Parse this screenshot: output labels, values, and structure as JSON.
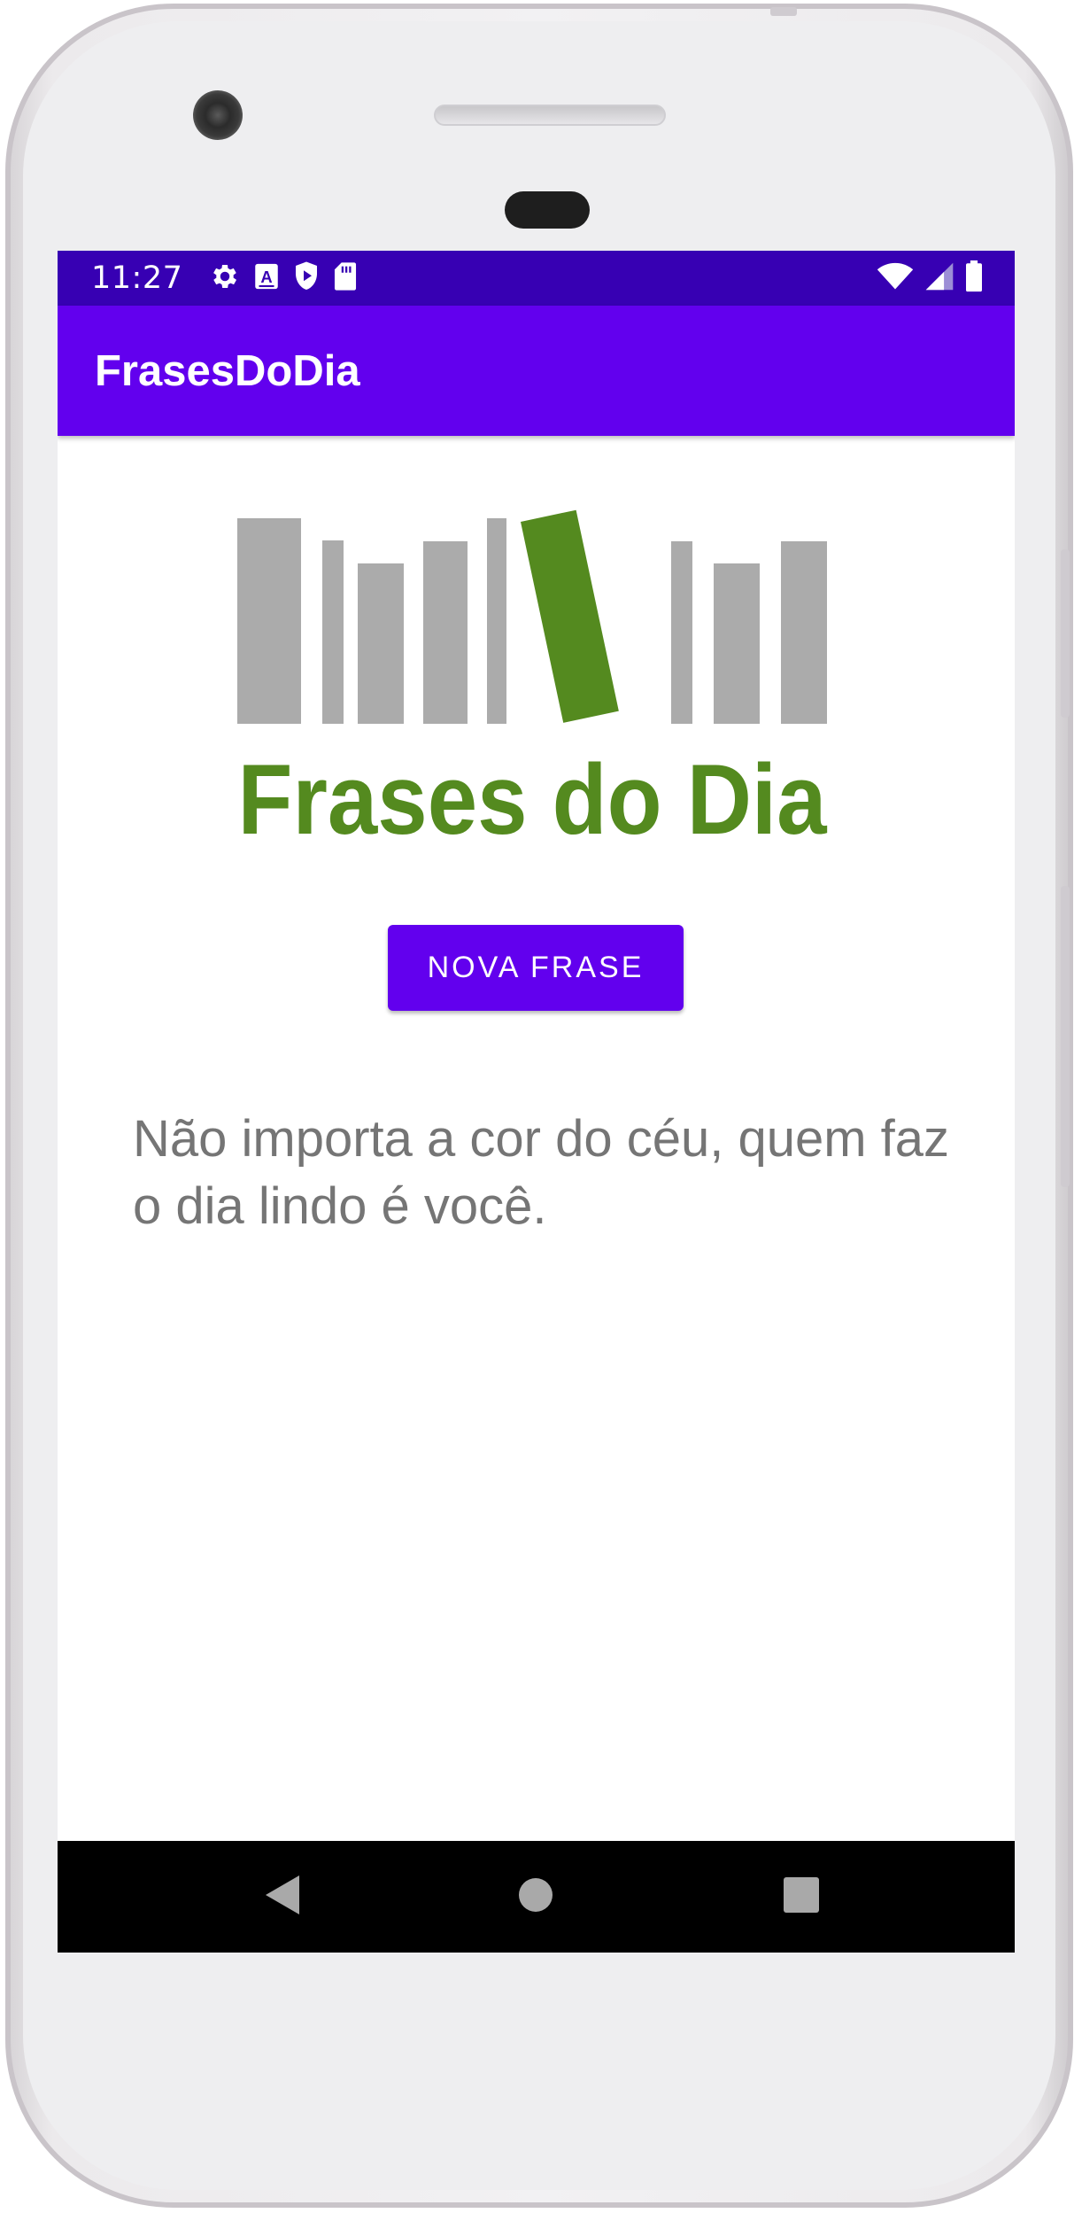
{
  "status_bar": {
    "time": "11:27",
    "left_icons": [
      "gear-icon",
      "text-a-icon",
      "shield-play-icon",
      "sd-card-icon"
    ],
    "right_icons": [
      "wifi-icon",
      "cell-signal-icon",
      "battery-icon"
    ],
    "background_color": "#3700b3"
  },
  "app_bar": {
    "title": "FrasesDoDia",
    "background_color": "#6200ee"
  },
  "logo": {
    "text": "Frases do Dia",
    "bar_color": "#ababab",
    "accent_color": "#548a1f"
  },
  "main": {
    "button_label": "NOVA FRASE",
    "phrase": "Não importa a cor do céu, quem faz o dia lindo é você."
  },
  "nav_bar": {
    "buttons": [
      "back-icon",
      "home-icon",
      "recents-icon"
    ]
  }
}
